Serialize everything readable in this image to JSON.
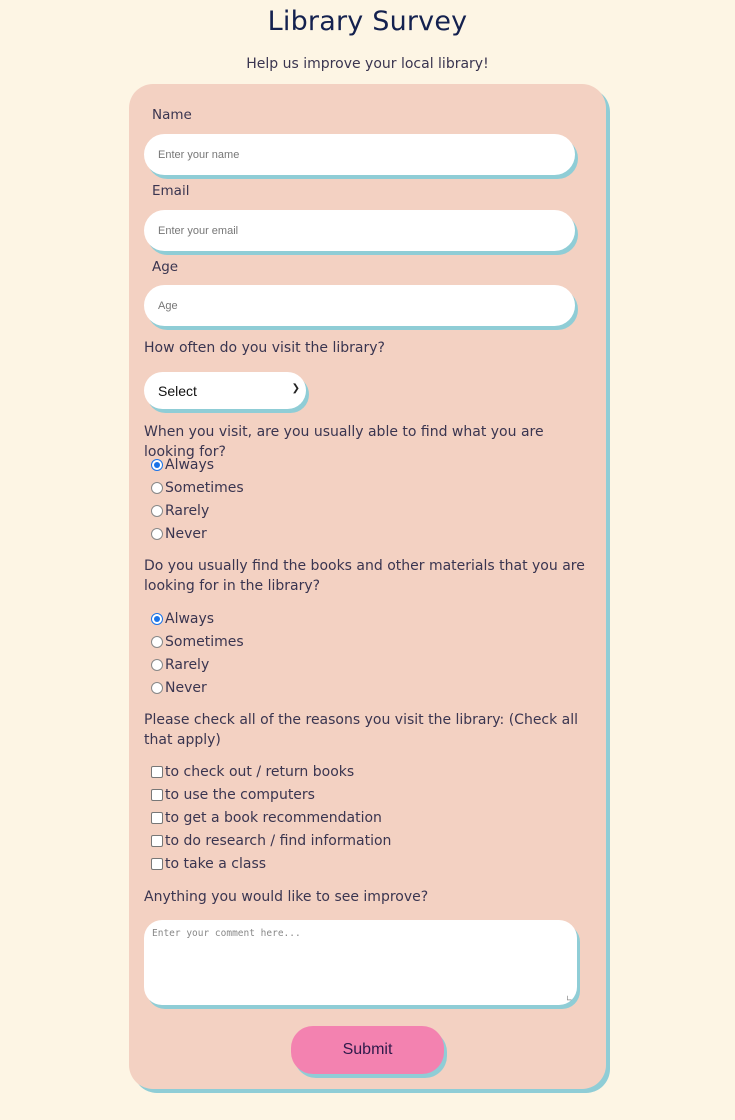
{
  "header": {
    "title": "Library Survey",
    "subtitle": "Help us improve your local library!"
  },
  "form": {
    "name": {
      "label": "Name",
      "placeholder": "Enter your name",
      "value": ""
    },
    "email": {
      "label": "Email",
      "placeholder": "Enter your email",
      "value": ""
    },
    "age": {
      "label": "Age",
      "placeholder": "Age",
      "value": ""
    },
    "visit_frequency": {
      "question": "How often do you visit the library?",
      "selected": "Select"
    },
    "find_what_looking": {
      "question": "When you visit, are you usually able to find what you are looking for?",
      "options": [
        "Always",
        "Sometimes",
        "Rarely",
        "Never"
      ],
      "selected": "Always"
    },
    "find_materials": {
      "question": "Do you usually find the books and other materials that you are looking for in the library?",
      "options": [
        "Always",
        "Sometimes",
        "Rarely",
        "Never"
      ],
      "selected": "Always"
    },
    "reasons": {
      "question": "Please check all of the reasons you visit the library: (Check all that apply)",
      "options": [
        "to check out / return books",
        "to use the computers",
        "to get a book recommendation",
        "to do research / find information",
        "to take a class"
      ],
      "checked": []
    },
    "improve": {
      "question": "Anything you would like to see improve?",
      "placeholder": "Enter your comment here...",
      "value": ""
    },
    "submit_label": "Submit"
  },
  "colors": {
    "background": "#fdf5e4",
    "card": "#f3d1c2",
    "shadow_accent": "#8fcdd6",
    "submit": "#f382b0",
    "title": "#14214f",
    "radio_selected": "#1a73e8"
  },
  "icons": {
    "select_chevron": "chevron-down-icon",
    "textarea_resize": "resize-grip-icon"
  }
}
